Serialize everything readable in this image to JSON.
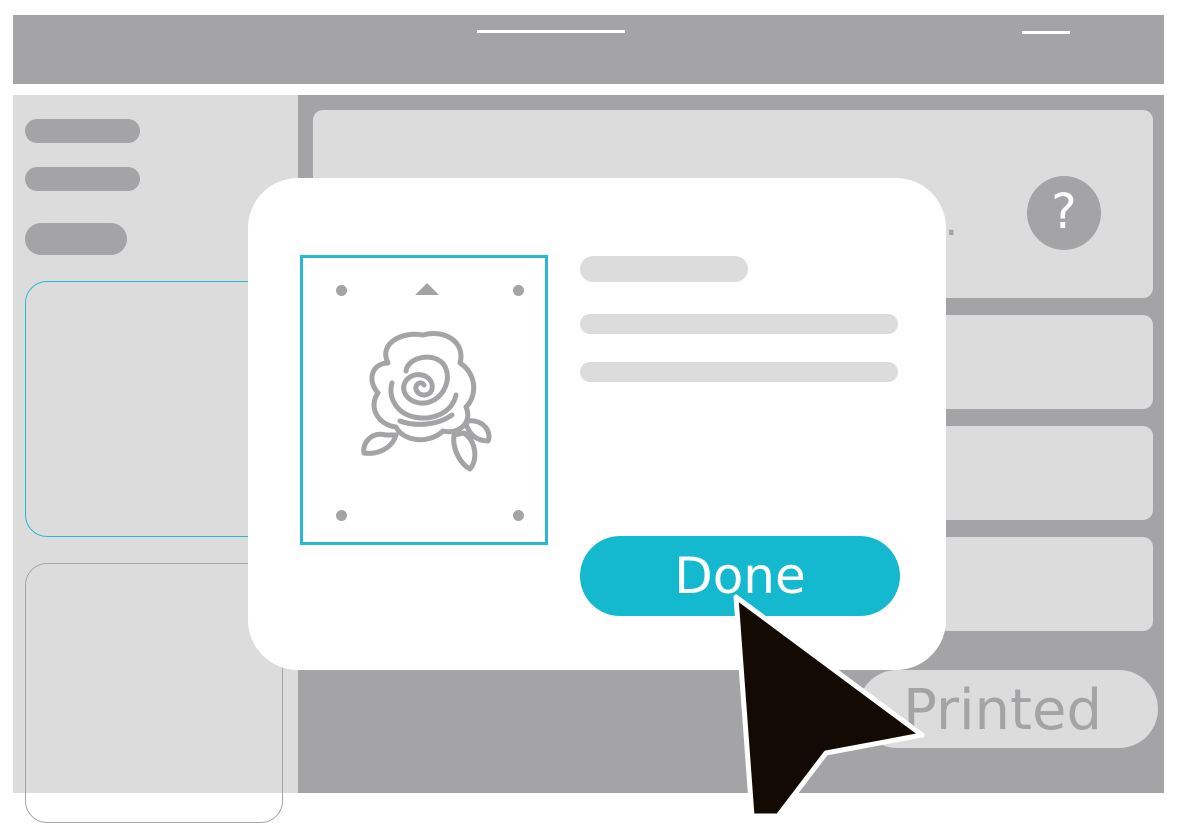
{
  "help_button": {
    "label": "?"
  },
  "main_card": {
    "truncated_text": "D..."
  },
  "printed_button": {
    "label": "Printed"
  },
  "dialog": {
    "done_label": "Done",
    "preview_image": "rose-icon"
  },
  "colors": {
    "accent": "#14b9d0",
    "gray": "#a4a4a6",
    "light_gray": "#dcdcdc",
    "cursor": "#140a04"
  }
}
